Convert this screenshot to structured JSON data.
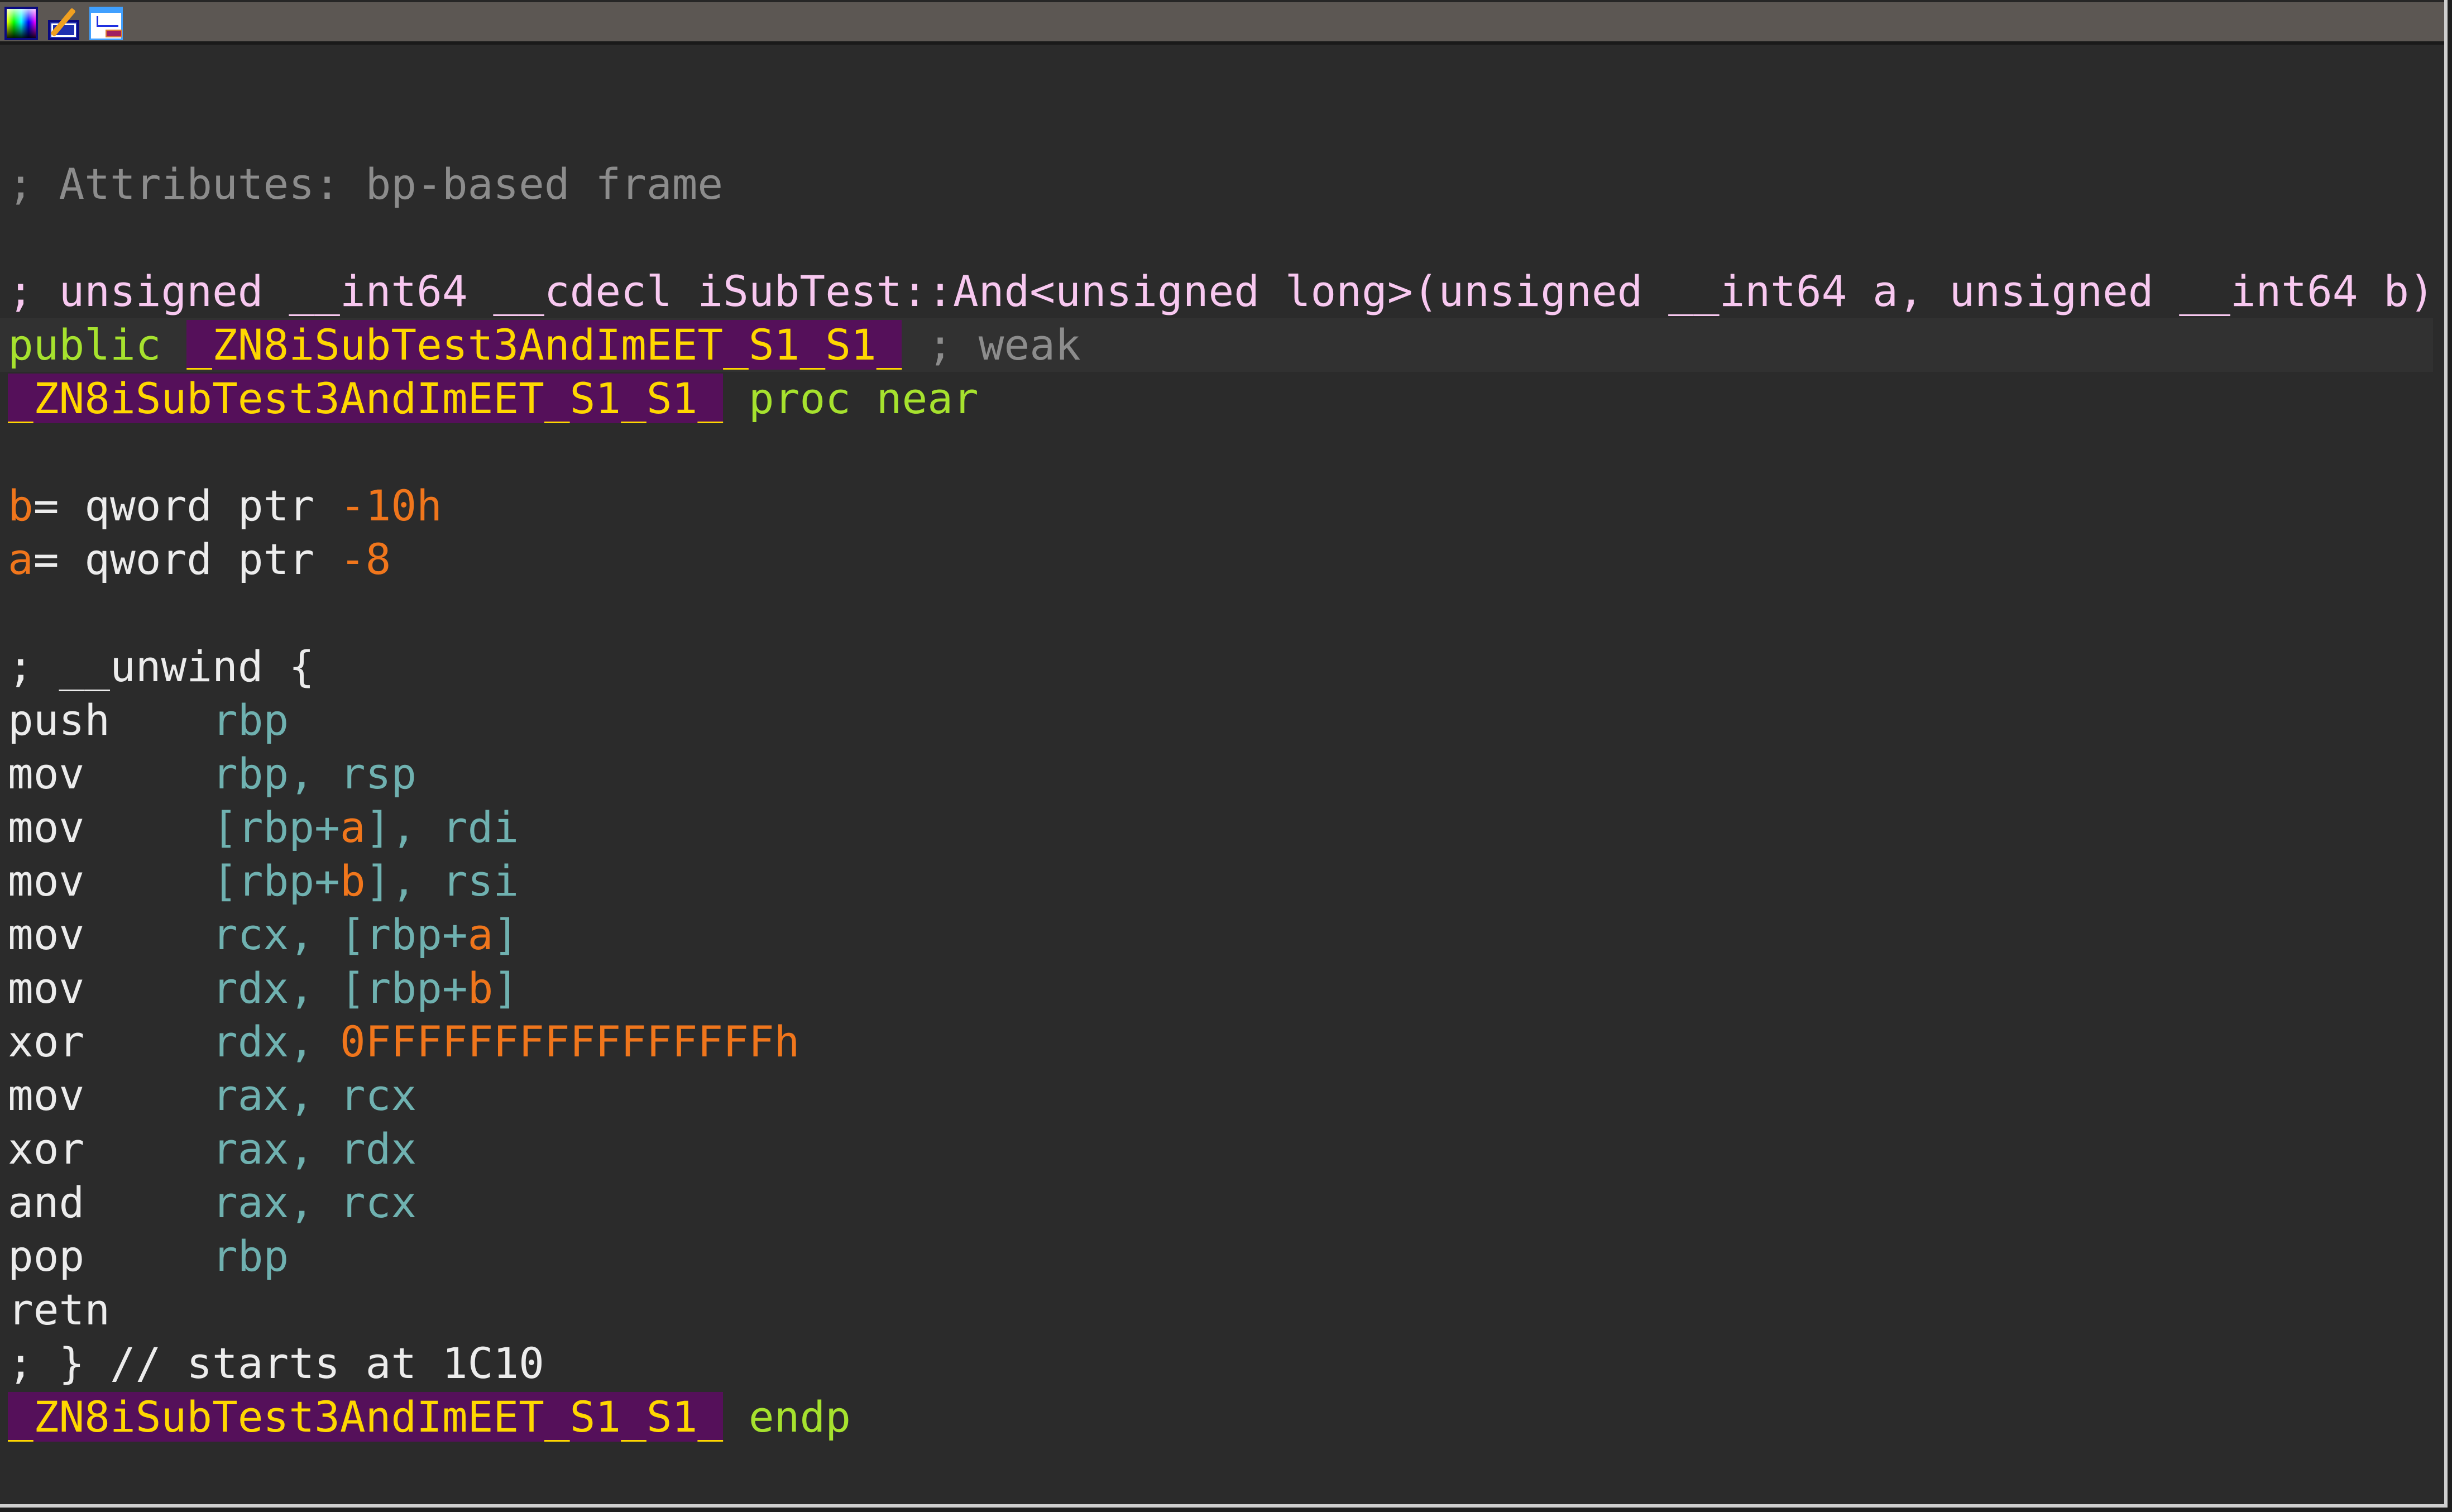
{
  "toolbar": {
    "buttons": [
      {
        "icon": "color-palette-icon"
      },
      {
        "icon": "edit-pencil-icon"
      },
      {
        "icon": "graph-view-icon"
      }
    ]
  },
  "colors": {
    "background": "#2b2b2b",
    "comment": "#8c8c8c",
    "prototype_comment": "#f8c8f0",
    "keyword": "#a6e22e",
    "function_name": "#ffd700",
    "function_name_bg": "#55105a",
    "stack_var_and_number": "#f0761c",
    "register": "#6fb1b0",
    "mnemonic": "#ececec"
  },
  "listing": [
    [
      {
        "t": "; Attributes: bp-based frame",
        "c": "gray"
      }
    ],
    [],
    [
      {
        "t": "; unsigned __int64 __cdecl iSubTest::And<unsigned long>(unsigned __int64 a, unsigned __int64 b)",
        "c": "pink"
      }
    ],
    [
      {
        "t": "public ",
        "c": "green"
      },
      {
        "t": "_ZN8iSubTest3AndImEET_S1_S1_",
        "c": "name"
      },
      {
        "t": " ; weak",
        "c": "gray"
      }
    ],
    [
      {
        "t": "_ZN8iSubTest3AndImEET_S1_S1_",
        "c": "name"
      },
      {
        "t": " proc near",
        "c": "green"
      }
    ],
    [],
    [
      {
        "t": "b",
        "c": "orange"
      },
      {
        "t": "= qword ptr ",
        "c": "white"
      },
      {
        "t": "-10h",
        "c": "orange"
      }
    ],
    [
      {
        "t": "a",
        "c": "orange"
      },
      {
        "t": "= qword ptr ",
        "c": "white"
      },
      {
        "t": "-8",
        "c": "orange"
      }
    ],
    [],
    [
      {
        "t": "; __unwind {",
        "c": "white"
      }
    ],
    [
      {
        "t": "push    ",
        "c": "white"
      },
      {
        "t": "rbp",
        "c": "reg"
      }
    ],
    [
      {
        "t": "mov     ",
        "c": "white"
      },
      {
        "t": "rbp, rsp",
        "c": "reg"
      }
    ],
    [
      {
        "t": "mov     ",
        "c": "white"
      },
      {
        "t": "[rbp+",
        "c": "reg"
      },
      {
        "t": "a",
        "c": "orange"
      },
      {
        "t": "], rdi",
        "c": "reg"
      }
    ],
    [
      {
        "t": "mov     ",
        "c": "white"
      },
      {
        "t": "[rbp+",
        "c": "reg"
      },
      {
        "t": "b",
        "c": "orange"
      },
      {
        "t": "], rsi",
        "c": "reg"
      }
    ],
    [
      {
        "t": "mov     ",
        "c": "white"
      },
      {
        "t": "rcx, [rbp+",
        "c": "reg"
      },
      {
        "t": "a",
        "c": "orange"
      },
      {
        "t": "]",
        "c": "reg"
      }
    ],
    [
      {
        "t": "mov     ",
        "c": "white"
      },
      {
        "t": "rdx, [rbp+",
        "c": "reg"
      },
      {
        "t": "b",
        "c": "orange"
      },
      {
        "t": "]",
        "c": "reg"
      }
    ],
    [
      {
        "t": "xor     ",
        "c": "white"
      },
      {
        "t": "rdx, ",
        "c": "reg"
      },
      {
        "t": "0FFFFFFFFFFFFFFFFh",
        "c": "orange"
      }
    ],
    [
      {
        "t": "mov     ",
        "c": "white"
      },
      {
        "t": "rax, rcx",
        "c": "reg"
      }
    ],
    [
      {
        "t": "xor     ",
        "c": "white"
      },
      {
        "t": "rax, rdx",
        "c": "reg"
      }
    ],
    [
      {
        "t": "and     ",
        "c": "white"
      },
      {
        "t": "rax, rcx",
        "c": "reg"
      }
    ],
    [
      {
        "t": "pop     ",
        "c": "white"
      },
      {
        "t": "rbp",
        "c": "reg"
      }
    ],
    [
      {
        "t": "retn",
        "c": "white"
      }
    ],
    [
      {
        "t": "; } // starts at 1C10",
        "c": "white"
      }
    ],
    [
      {
        "t": "_ZN8iSubTest3AndImEET_S1_S1_",
        "c": "name"
      },
      {
        "t": " endp",
        "c": "green"
      }
    ]
  ]
}
